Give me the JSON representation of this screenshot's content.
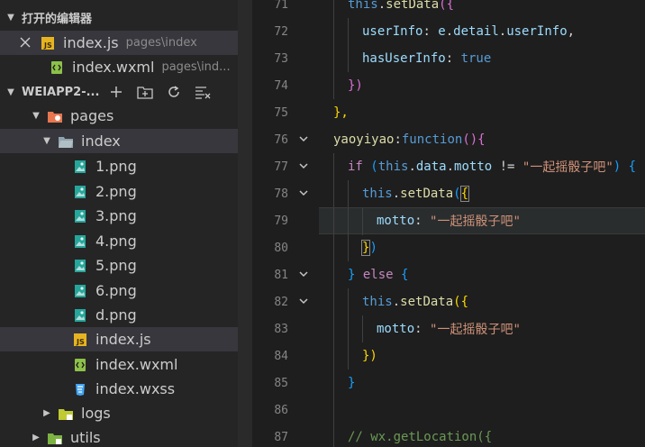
{
  "sidebar": {
    "open_editors": {
      "title": "打开的编辑器",
      "files": [
        {
          "name": "index.js",
          "path": "pages\\index",
          "active": true,
          "icon": "js-file-icon"
        },
        {
          "name": "index.wxml",
          "path": "pages\\ind...",
          "active": false,
          "icon": "wxml-file-icon"
        }
      ]
    },
    "project": {
      "title": "WEIAPP2-...",
      "actions": [
        "new-file-icon",
        "new-folder-icon",
        "refresh-icon",
        "collapse-all-icon"
      ]
    },
    "tree": [
      {
        "label": "pages",
        "type": "folder",
        "expanded": true
      },
      {
        "label": "index",
        "type": "folder",
        "expanded": true
      },
      {
        "label": "1.png",
        "type": "image"
      },
      {
        "label": "2.png",
        "type": "image"
      },
      {
        "label": "3.png",
        "type": "image"
      },
      {
        "label": "4.png",
        "type": "image"
      },
      {
        "label": "5.png",
        "type": "image"
      },
      {
        "label": "6.png",
        "type": "image"
      },
      {
        "label": "d.png",
        "type": "image"
      },
      {
        "label": "index.js",
        "type": "js",
        "active": true
      },
      {
        "label": "index.wxml",
        "type": "wxml"
      },
      {
        "label": "index.wxss",
        "type": "wxss"
      },
      {
        "label": "logs",
        "type": "folder",
        "expanded": false
      },
      {
        "label": "utils",
        "type": "folder",
        "expanded": false
      }
    ]
  },
  "editor": {
    "lines": [
      {
        "n": "71",
        "t": [
          "this",
          ".",
          "setData",
          "({"
        ]
      },
      {
        "n": "72",
        "t": [
          "userInfo",
          ": ",
          "e",
          ".",
          "detail",
          ".",
          "userInfo",
          ","
        ]
      },
      {
        "n": "73",
        "t": [
          "hasUserInfo",
          ": ",
          "true"
        ]
      },
      {
        "n": "74",
        "t": [
          "})"
        ]
      },
      {
        "n": "75",
        "t": [
          "},"
        ]
      },
      {
        "n": "76",
        "t": [
          "yaoyiyao",
          ":",
          "function",
          "(){"
        ]
      },
      {
        "n": "77",
        "t": [
          "if",
          " (",
          "this",
          ".",
          "data",
          ".",
          "motto",
          " != ",
          "\"一起摇骰子吧\"",
          ") {"
        ]
      },
      {
        "n": "78",
        "t": [
          "this",
          ".",
          "setData",
          "(",
          "{"
        ]
      },
      {
        "n": "79",
        "t": [
          "motto",
          ": ",
          "\"一起摇骰子吧\""
        ]
      },
      {
        "n": "80",
        "t": [
          "}",
          ")"
        ]
      },
      {
        "n": "81",
        "t": [
          "} ",
          "else",
          " {"
        ]
      },
      {
        "n": "82",
        "t": [
          "this",
          ".",
          "setData",
          "({"
        ]
      },
      {
        "n": "83",
        "t": [
          "motto",
          ": ",
          "\"一起摇骰子吧\""
        ]
      },
      {
        "n": "84",
        "t": [
          "})"
        ]
      },
      {
        "n": "85",
        "t": [
          "}"
        ]
      },
      {
        "n": "86",
        "t": []
      },
      {
        "n": "87",
        "t": [
          "// wx.getLocation({"
        ]
      }
    ]
  },
  "colors": {
    "sidebar_bg": "#252526",
    "editor_bg": "#1e1e1e",
    "active_row": "#37373d",
    "keyword": "#569cd6",
    "string": "#ce9178",
    "method": "#dcdcaa"
  }
}
